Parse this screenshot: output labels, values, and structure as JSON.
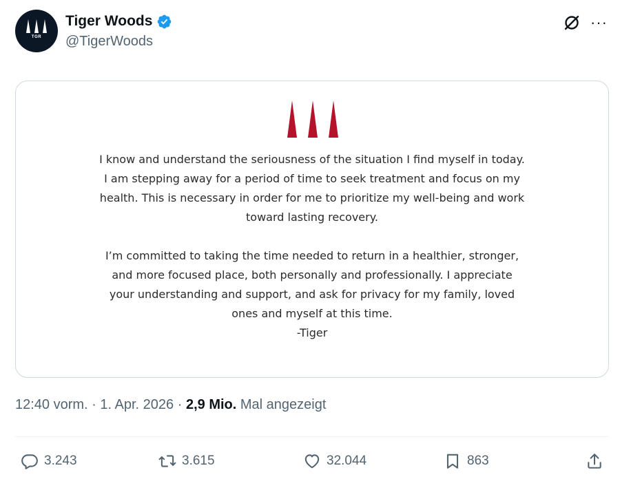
{
  "colors": {
    "text_primary": "#0f1419",
    "text_secondary": "#536471",
    "verified_blue": "#1d9bf0",
    "logo_red": "#b5122b",
    "avatar_bg": "#0c1726",
    "border": "#cfd9de"
  },
  "author": {
    "display_name": "Tiger Woods",
    "handle": "@TigerWoods",
    "avatar_text": "TGR",
    "verified": true
  },
  "header_icons": [
    "grok-icon",
    "more-icon"
  ],
  "more_label": "···",
  "statement": {
    "paragraph_1": [
      "I know and understand the seriousness of the situation I find myself in today.",
      "I am stepping away for a period of time to seek treatment and focus on my",
      "health. This is necessary in order for me to prioritize my well-being and work",
      "toward lasting recovery."
    ],
    "paragraph_2": [
      "I’m committed to taking the time needed to return in a healthier, stronger,",
      "and more focused place, both personally and professionally. I appreciate",
      "your understanding and support, and ask for privacy for my family, loved",
      "ones and myself at this time."
    ],
    "signature": "-Tiger"
  },
  "meta": {
    "time": "12:40 vorm.",
    "separator": "·",
    "date": "1. Apr. 2026",
    "views_count": "2,9 Mio.",
    "views_label": "Mal angezeigt"
  },
  "actions": {
    "replies": "3.243",
    "reposts": "3.615",
    "likes": "32.044",
    "bookmarks": "863"
  }
}
